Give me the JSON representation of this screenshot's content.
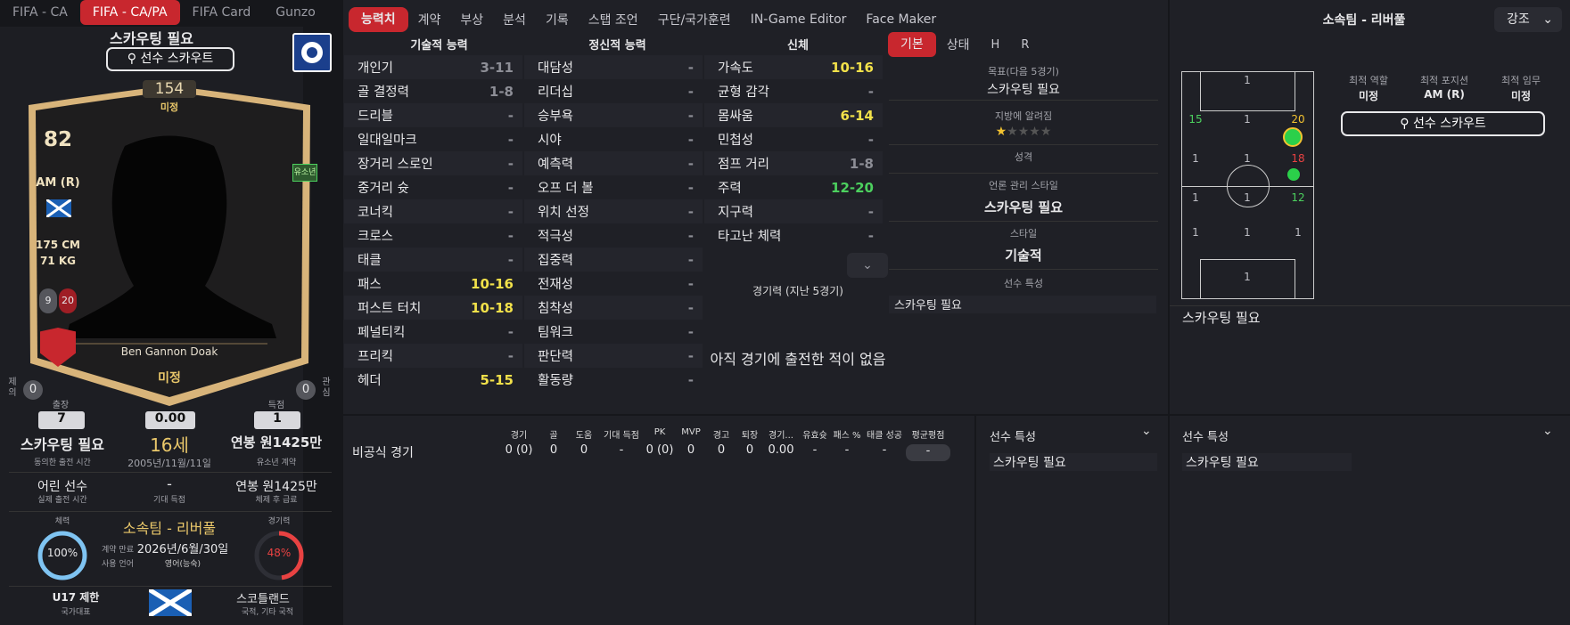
{
  "top_tabs": [
    "FIFA - CA",
    "FIFA - CA/PA",
    "FIFA Card",
    "Gunzo"
  ],
  "profile_tabs": [
    "능력치",
    "계약",
    "부상",
    "분석",
    "기록",
    "스탭 조언",
    "구단/국가훈련",
    "IN-Game Editor",
    "Face Maker"
  ],
  "card": {
    "title": "스카우팅 필요",
    "scout_btn": "선수 스카우트",
    "overall": "154",
    "overall_sub": "미정",
    "rating": "82",
    "position": "AM (R)",
    "height": "175 CM",
    "weight": "71 KG",
    "badge_left": "9",
    "badge_right": "20",
    "youth_tag": "유소년",
    "name": "Ben Gannon Doak",
    "bottom": "미정",
    "left_side_label": "제의",
    "left_side_value": "0",
    "right_side_label": "관심",
    "right_side_value": "0"
  },
  "stats_row": {
    "apps_label": "출장",
    "apps": "7",
    "rating_val": "0.00",
    "goals_label": "득점",
    "goals": "1"
  },
  "info": {
    "played_time": "스카우팅 필요",
    "played_time_sub": "동의한 출전 시간",
    "age": "16세",
    "birth": "2005년/11월/11일",
    "wage": "연봉 원1425만",
    "wage_sub": "유소년 계약",
    "status": "어린 선수",
    "status_sub": "실제 출전 시간",
    "expected_goals": "-",
    "expected_goals_sub": "기대 득점",
    "wage2": "연봉 원1425만",
    "wage2_sub": "체제 후 급료"
  },
  "club": {
    "fitness_label": "체력",
    "fitness": "100%",
    "contract_lbl1": "계약 만료",
    "contract_lbl2": "사용 언어",
    "club_name": "소속팀 - 리버풀",
    "contract_end": "2026년/6월/30일",
    "language": "영어(능숙)",
    "form_label": "경기력",
    "form": "48%"
  },
  "nation": {
    "label": "U17 제한",
    "sub": "국가대표",
    "country": "스코틀랜드",
    "country_sub": "국적, 기타 국적"
  },
  "attrs": {
    "technical_head": "기술적 능력",
    "mental_head": "정신적 능력",
    "physical_head": "신체",
    "technical": [
      [
        "개인기",
        "3-11"
      ],
      [
        "골 결정력",
        "1-8"
      ],
      [
        "드리블",
        "-"
      ],
      [
        "일대일마크",
        "-"
      ],
      [
        "장거리 스로인",
        "-"
      ],
      [
        "중거리 슛",
        "-"
      ],
      [
        "코너킥",
        "-"
      ],
      [
        "크로스",
        "-"
      ],
      [
        "태클",
        "-"
      ],
      [
        "패스",
        "10-16"
      ],
      [
        "퍼스트 터치",
        "10-18"
      ],
      [
        "페널티킥",
        "-"
      ],
      [
        "프리킥",
        "-"
      ],
      [
        "헤더",
        "5-15"
      ]
    ],
    "mental": [
      [
        "대담성",
        "-"
      ],
      [
        "리더십",
        "-"
      ],
      [
        "승부욕",
        "-"
      ],
      [
        "시야",
        "-"
      ],
      [
        "예측력",
        "-"
      ],
      [
        "오프 더 볼",
        "-"
      ],
      [
        "위치 선정",
        "-"
      ],
      [
        "적극성",
        "-"
      ],
      [
        "집중력",
        "-"
      ],
      [
        "전재성",
        "-"
      ],
      [
        "침착성",
        "-"
      ],
      [
        "팀워크",
        "-"
      ],
      [
        "판단력",
        "-"
      ],
      [
        "활동량",
        "-"
      ]
    ],
    "physical": [
      [
        "가속도",
        "10-16"
      ],
      [
        "균형 감각",
        "-"
      ],
      [
        "몸싸움",
        "6-14"
      ],
      [
        "민첩성",
        "-"
      ],
      [
        "점프 거리",
        "1-8"
      ],
      [
        "주력",
        "12-20"
      ],
      [
        "지구력",
        "-"
      ],
      [
        "타고난 체력",
        "-"
      ]
    ],
    "form_label": "경기력 (지난 5경기)",
    "no_games": "아직 경기에 출전한 적이 없음"
  },
  "side_tabs": [
    "기본",
    "상태",
    "H",
    "R"
  ],
  "basic": {
    "target_label": "목표(다음 5경기)",
    "target": "스카우팅 필요",
    "fame_label": "지방에 알려짐",
    "personality_label": "성격",
    "media_label": "언론 관리 스타일",
    "media": "스카우팅 필요",
    "style_label": "스타일",
    "style": "기술적",
    "traits_label": "선수 특성",
    "traits": "스카우팅 필요"
  },
  "right_panel": {
    "title": "소속팀 - 리버풀",
    "dropdown": "강조",
    "role_label": "최적 역할",
    "role": "미정",
    "pos_label": "최적 포지션",
    "pos": "AM (R)",
    "duty_label": "최적 임무",
    "duty": "미정",
    "scout_btn": "선수 스카우트",
    "footer": "스카우팅 필요"
  },
  "pitch_nums": [
    "1",
    "1",
    "15",
    "1",
    "20",
    "1",
    "1",
    "18",
    "1",
    "1",
    "12",
    "1",
    "1",
    "1",
    "1"
  ],
  "season_table": {
    "headers": [
      "경기",
      "골",
      "도움",
      "기대 득점",
      "PK",
      "MVP",
      "경고",
      "퇴장",
      "경기...",
      "유효슛",
      "패스 %",
      "태클 성공",
      "평균평점"
    ],
    "row_label": "비공식 경기",
    "values": [
      "0 (0)",
      "0",
      "0",
      "-",
      "0 (0)",
      "0",
      "0",
      "0",
      "0.00",
      "-",
      "-",
      "-",
      "-"
    ]
  },
  "traits_box1": {
    "title": "선수 특성",
    "value": "스카우팅 필요"
  },
  "traits_box2": {
    "title": "선수 특성",
    "value": "스카우팅 필요"
  }
}
